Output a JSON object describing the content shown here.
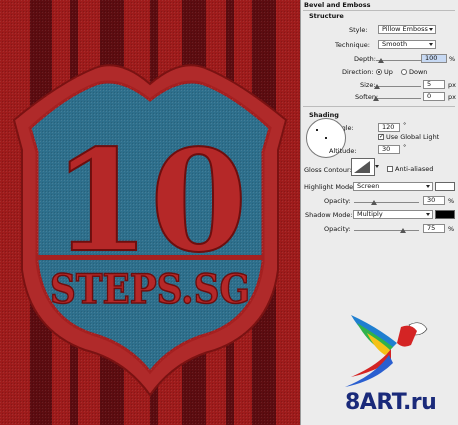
{
  "artwork": {
    "shield_number": "10",
    "shield_text": "STEPS.SG",
    "colors": {
      "fabric_red": "#9e1b1b",
      "stripe_dark": "#5c0c10",
      "shield_blue": "#2e6f8c",
      "shield_border": "#b02a2a"
    }
  },
  "watermark": {
    "text": "8ART.ru",
    "bird_icon": "parrot-icon",
    "color": "#1a2a7a"
  },
  "panel": {
    "title": "Bevel and Emboss",
    "structure": {
      "heading": "Structure",
      "style_label": "Style:",
      "style_value": "Pillow Emboss",
      "technique_label": "Technique:",
      "technique_value": "Smooth",
      "depth_label": "Depth:",
      "depth_value": "100",
      "depth_unit": "%",
      "depth_level": 1.0,
      "direction_label": "Direction:",
      "direction_up": "Up",
      "direction_down": "Down",
      "direction_selected": "Up",
      "size_label": "Size:",
      "size_value": "5",
      "size_unit": "px",
      "size_level": 0.02,
      "soften_label": "Soften:",
      "soften_value": "0",
      "soften_unit": "px",
      "soften_level": 0.0
    },
    "shading": {
      "heading": "Shading",
      "angle_label": "Angle:",
      "angle_value": "120",
      "angle_unit": "°",
      "global_light_label": "Use Global Light",
      "global_light_checked": true,
      "altitude_label": "Altitude:",
      "altitude_value": "30",
      "altitude_unit": "°",
      "gloss_label": "Gloss Contour:",
      "anti_aliased_label": "Anti-aliased",
      "anti_aliased_checked": false,
      "highlight_mode_label": "Highlight Mode:",
      "highlight_mode_value": "Screen",
      "highlight_color": "#ffffff",
      "highlight_opacity_label": "Opacity:",
      "highlight_opacity_value": "30",
      "highlight_opacity_unit": "%",
      "highlight_opacity_level": 0.3,
      "shadow_mode_label": "Shadow Mode:",
      "shadow_mode_value": "Multiply",
      "shadow_color": "#000000",
      "shadow_opacity_label": "Opacity:",
      "shadow_opacity_value": "75",
      "shadow_opacity_unit": "%",
      "shadow_opacity_level": 0.75
    }
  }
}
